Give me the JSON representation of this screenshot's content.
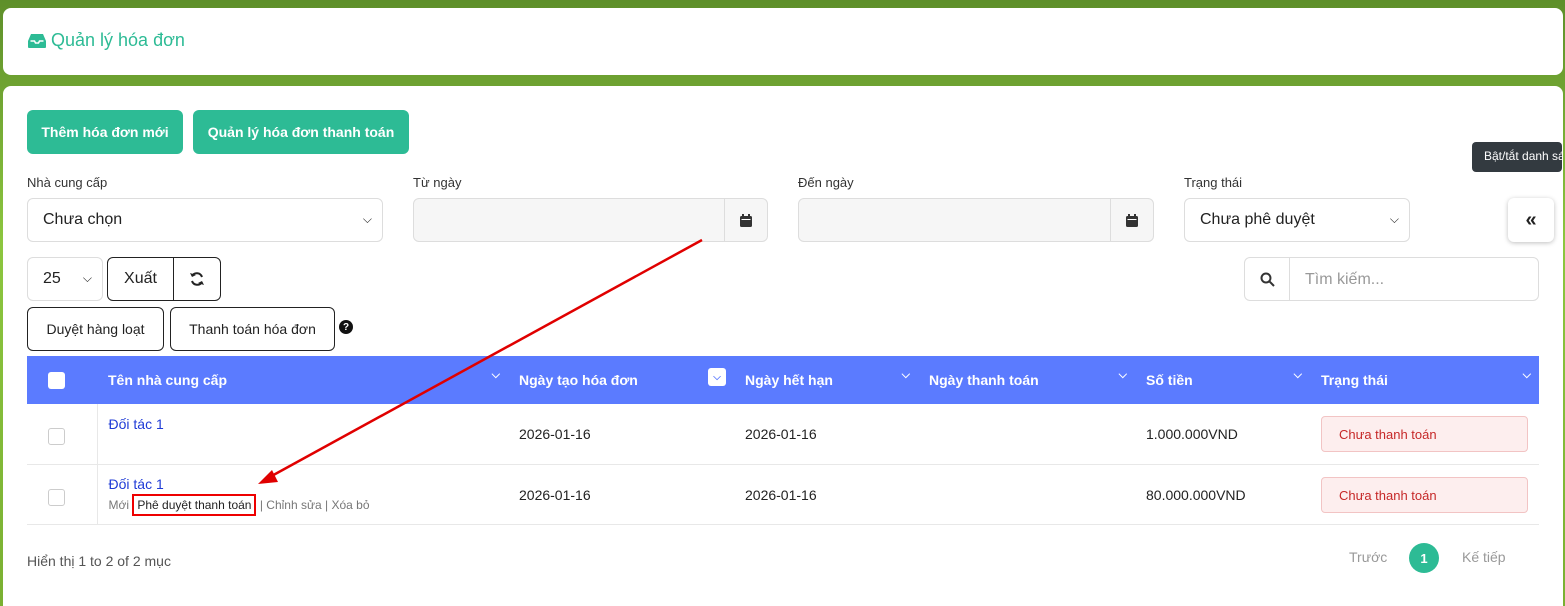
{
  "header": {
    "title": "Quản lý hóa đơn",
    "icon": "inbox-icon"
  },
  "toolbar": {
    "add_invoice": "Thêm hóa đơn mới",
    "manage_payment": "Quản lý hóa đơn thanh toán"
  },
  "filters": {
    "supplier_label": "Nhà cung cấp",
    "supplier_value": "Chưa chọn",
    "from_label": "Từ ngày",
    "from_value": "",
    "to_label": "Đến ngày",
    "to_value": "",
    "status_label": "Trạng thái",
    "status_value": "Chưa phê duyệt"
  },
  "tooltip": "Bật/tắt danh sách",
  "controls": {
    "page_size": "25",
    "export": "Xuất",
    "bulk_approve": "Duyệt hàng loạt",
    "pay_invoice": "Thanh toán hóa đơn",
    "search_placeholder": "Tìm kiếm...",
    "help": "?"
  },
  "table": {
    "columns": [
      "Tên nhà cung cấp",
      "Ngày tạo hóa đơn",
      "Ngày hết hạn",
      "Ngày thanh toán",
      "Số tiền",
      "Trạng thái"
    ],
    "rows": [
      {
        "supplier": "Đối tác 1",
        "created": "2026-01-16",
        "due": "2026-01-16",
        "paid": "",
        "amount": "1.000.000VND",
        "status": "Chưa thanh toán"
      },
      {
        "supplier": "Đối tác 1",
        "created": "2026-01-16",
        "due": "2026-01-16",
        "paid": "",
        "amount": "80.000.000VND",
        "status": "Chưa thanh toán",
        "actions": {
          "new": "Mới",
          "approve": "Phê duyệt thanh toán",
          "edit": "Chỉnh sửa",
          "delete": "Xóa bỏ"
        }
      }
    ]
  },
  "footer": {
    "info": "Hiển thị 1 to 2 of 2 mục",
    "prev": "Trước",
    "page": "1",
    "next": "Kế tiếp"
  },
  "colors": {
    "accent": "#2dbb95",
    "table_header": "#5b7bff",
    "status_text": "#c62828",
    "annotation": "#e00000"
  }
}
